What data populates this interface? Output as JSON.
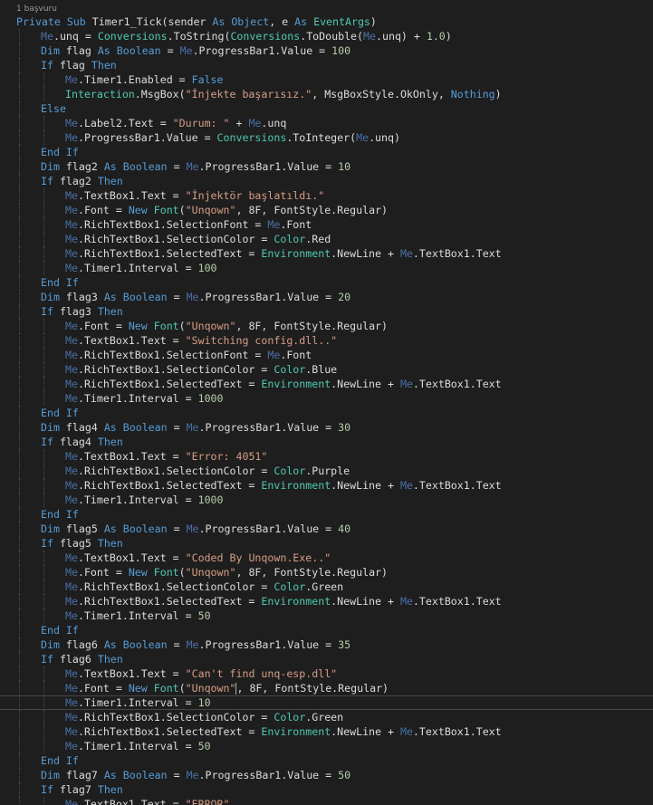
{
  "editor": {
    "codelens": "1 başvuru",
    "current_line": 47,
    "colors": {
      "background": "#1e1e1e",
      "keyword": "#569cd6",
      "type": "#4ec9b0",
      "string": "#d69d85",
      "number": "#b5cea8",
      "identifier": "#dcdcdc",
      "me": "#4a6fa5"
    },
    "lines": [
      {
        "indent": 0,
        "tokens": [
          [
            "kw",
            "Private Sub "
          ],
          [
            "id",
            "Timer1_Tick(sender "
          ],
          [
            "kw",
            "As Object"
          ],
          [
            "id",
            ", e "
          ],
          [
            "kw",
            "As "
          ],
          [
            "ty",
            "EventArgs"
          ],
          [
            "id",
            ")"
          ]
        ]
      },
      {
        "indent": 1,
        "tokens": [
          [
            "me",
            "Me"
          ],
          [
            "id",
            ".unq = "
          ],
          [
            "ty",
            "Conversions"
          ],
          [
            "id",
            ".ToString("
          ],
          [
            "ty",
            "Conversions"
          ],
          [
            "id",
            ".ToDouble("
          ],
          [
            "me",
            "Me"
          ],
          [
            "id",
            ".unq) + "
          ],
          [
            "num",
            "1.0"
          ],
          [
            "id",
            ")"
          ]
        ]
      },
      {
        "indent": 1,
        "tokens": [
          [
            "kw",
            "Dim "
          ],
          [
            "id",
            "flag "
          ],
          [
            "kw",
            "As Boolean"
          ],
          [
            "id",
            " = "
          ],
          [
            "me",
            "Me"
          ],
          [
            "id",
            ".ProgressBar1.Value = "
          ],
          [
            "num",
            "100"
          ]
        ]
      },
      {
        "indent": 1,
        "tokens": [
          [
            "kw",
            "If "
          ],
          [
            "id",
            "flag "
          ],
          [
            "kw",
            "Then"
          ]
        ]
      },
      {
        "indent": 2,
        "tokens": [
          [
            "me",
            "Me"
          ],
          [
            "id",
            ".Timer1.Enabled = "
          ],
          [
            "kw",
            "False"
          ]
        ]
      },
      {
        "indent": 2,
        "tokens": [
          [
            "ty",
            "Interaction"
          ],
          [
            "id",
            ".MsgBox("
          ],
          [
            "str",
            "\"İnjekte başarısız.\""
          ],
          [
            "id",
            ", MsgBoxStyle.OkOnly, "
          ],
          [
            "kw",
            "Nothing"
          ],
          [
            "id",
            ")"
          ]
        ]
      },
      {
        "indent": 1,
        "tokens": [
          [
            "kw",
            "Else"
          ]
        ]
      },
      {
        "indent": 2,
        "tokens": [
          [
            "me",
            "Me"
          ],
          [
            "id",
            ".Label2.Text = "
          ],
          [
            "str",
            "\"Durum: \""
          ],
          [
            "id",
            " + "
          ],
          [
            "me",
            "Me"
          ],
          [
            "id",
            ".unq"
          ]
        ]
      },
      {
        "indent": 2,
        "tokens": [
          [
            "me",
            "Me"
          ],
          [
            "id",
            ".ProgressBar1.Value = "
          ],
          [
            "ty",
            "Conversions"
          ],
          [
            "id",
            ".ToInteger("
          ],
          [
            "me",
            "Me"
          ],
          [
            "id",
            ".unq)"
          ]
        ]
      },
      {
        "indent": 1,
        "tokens": [
          [
            "kw",
            "End If"
          ]
        ]
      },
      {
        "indent": 1,
        "tokens": [
          [
            "kw",
            "Dim "
          ],
          [
            "id",
            "flag2 "
          ],
          [
            "kw",
            "As Boolean"
          ],
          [
            "id",
            " = "
          ],
          [
            "me",
            "Me"
          ],
          [
            "id",
            ".ProgressBar1.Value = "
          ],
          [
            "num",
            "10"
          ]
        ]
      },
      {
        "indent": 1,
        "tokens": [
          [
            "kw",
            "If "
          ],
          [
            "id",
            "flag2 "
          ],
          [
            "kw",
            "Then"
          ]
        ]
      },
      {
        "indent": 2,
        "tokens": [
          [
            "me",
            "Me"
          ],
          [
            "id",
            ".TextBox1.Text = "
          ],
          [
            "str",
            "\"İnjektör başlatıldı.\""
          ]
        ]
      },
      {
        "indent": 2,
        "tokens": [
          [
            "me",
            "Me"
          ],
          [
            "id",
            ".Font = "
          ],
          [
            "kw",
            "New "
          ],
          [
            "ty",
            "Font"
          ],
          [
            "id",
            "("
          ],
          [
            "str",
            "\"Unqown\""
          ],
          [
            "id",
            ", 8F, FontStyle.Regular)"
          ]
        ]
      },
      {
        "indent": 2,
        "tokens": [
          [
            "me",
            "Me"
          ],
          [
            "id",
            ".RichTextBox1.SelectionFont = "
          ],
          [
            "me",
            "Me"
          ],
          [
            "id",
            ".Font"
          ]
        ]
      },
      {
        "indent": 2,
        "tokens": [
          [
            "me",
            "Me"
          ],
          [
            "id",
            ".RichTextBox1.SelectionColor = "
          ],
          [
            "ty",
            "Color"
          ],
          [
            "id",
            ".Red"
          ]
        ]
      },
      {
        "indent": 2,
        "tokens": [
          [
            "me",
            "Me"
          ],
          [
            "id",
            ".RichTextBox1.SelectedText = "
          ],
          [
            "ty",
            "Environment"
          ],
          [
            "id",
            ".NewLine + "
          ],
          [
            "me",
            "Me"
          ],
          [
            "id",
            ".TextBox1.Text"
          ]
        ]
      },
      {
        "indent": 2,
        "tokens": [
          [
            "me",
            "Me"
          ],
          [
            "id",
            ".Timer1.Interval = "
          ],
          [
            "num",
            "100"
          ]
        ]
      },
      {
        "indent": 1,
        "tokens": [
          [
            "kw",
            "End If"
          ]
        ]
      },
      {
        "indent": 1,
        "tokens": [
          [
            "kw",
            "Dim "
          ],
          [
            "id",
            "flag3 "
          ],
          [
            "kw",
            "As Boolean"
          ],
          [
            "id",
            " = "
          ],
          [
            "me",
            "Me"
          ],
          [
            "id",
            ".ProgressBar1.Value = "
          ],
          [
            "num",
            "20"
          ]
        ]
      },
      {
        "indent": 1,
        "tokens": [
          [
            "kw",
            "If "
          ],
          [
            "id",
            "flag3 "
          ],
          [
            "kw",
            "Then"
          ]
        ]
      },
      {
        "indent": 2,
        "tokens": [
          [
            "me",
            "Me"
          ],
          [
            "id",
            ".Font = "
          ],
          [
            "kw",
            "New "
          ],
          [
            "ty",
            "Font"
          ],
          [
            "id",
            "("
          ],
          [
            "str",
            "\"Unqown\""
          ],
          [
            "id",
            ", 8F, FontStyle.Regular)"
          ]
        ]
      },
      {
        "indent": 2,
        "tokens": [
          [
            "me",
            "Me"
          ],
          [
            "id",
            ".TextBox1.Text = "
          ],
          [
            "str",
            "\"Switching config.dll..\""
          ]
        ]
      },
      {
        "indent": 2,
        "tokens": [
          [
            "me",
            "Me"
          ],
          [
            "id",
            ".RichTextBox1.SelectionFont = "
          ],
          [
            "me",
            "Me"
          ],
          [
            "id",
            ".Font"
          ]
        ]
      },
      {
        "indent": 2,
        "tokens": [
          [
            "me",
            "Me"
          ],
          [
            "id",
            ".RichTextBox1.SelectionColor = "
          ],
          [
            "ty",
            "Color"
          ],
          [
            "id",
            ".Blue"
          ]
        ]
      },
      {
        "indent": 2,
        "tokens": [
          [
            "me",
            "Me"
          ],
          [
            "id",
            ".RichTextBox1.SelectedText = "
          ],
          [
            "ty",
            "Environment"
          ],
          [
            "id",
            ".NewLine + "
          ],
          [
            "me",
            "Me"
          ],
          [
            "id",
            ".TextBox1.Text"
          ]
        ]
      },
      {
        "indent": 2,
        "tokens": [
          [
            "me",
            "Me"
          ],
          [
            "id",
            ".Timer1.Interval = "
          ],
          [
            "num",
            "1000"
          ]
        ]
      },
      {
        "indent": 1,
        "tokens": [
          [
            "kw",
            "End If"
          ]
        ]
      },
      {
        "indent": 1,
        "tokens": [
          [
            "kw",
            "Dim "
          ],
          [
            "id",
            "flag4 "
          ],
          [
            "kw",
            "As Boolean"
          ],
          [
            "id",
            " = "
          ],
          [
            "me",
            "Me"
          ],
          [
            "id",
            ".ProgressBar1.Value = "
          ],
          [
            "num",
            "30"
          ]
        ]
      },
      {
        "indent": 1,
        "tokens": [
          [
            "kw",
            "If "
          ],
          [
            "id",
            "flag4 "
          ],
          [
            "kw",
            "Then"
          ]
        ]
      },
      {
        "indent": 2,
        "tokens": [
          [
            "me",
            "Me"
          ],
          [
            "id",
            ".TextBox1.Text = "
          ],
          [
            "str",
            "\"Error: 4051\""
          ]
        ]
      },
      {
        "indent": 2,
        "tokens": [
          [
            "me",
            "Me"
          ],
          [
            "id",
            ".RichTextBox1.SelectionColor = "
          ],
          [
            "ty",
            "Color"
          ],
          [
            "id",
            ".Purple"
          ]
        ]
      },
      {
        "indent": 2,
        "tokens": [
          [
            "me",
            "Me"
          ],
          [
            "id",
            ".RichTextBox1.SelectedText = "
          ],
          [
            "ty",
            "Environment"
          ],
          [
            "id",
            ".NewLine + "
          ],
          [
            "me",
            "Me"
          ],
          [
            "id",
            ".TextBox1.Text"
          ]
        ]
      },
      {
        "indent": 2,
        "tokens": [
          [
            "me",
            "Me"
          ],
          [
            "id",
            ".Timer1.Interval = "
          ],
          [
            "num",
            "1000"
          ]
        ]
      },
      {
        "indent": 1,
        "tokens": [
          [
            "kw",
            "End If"
          ]
        ]
      },
      {
        "indent": 1,
        "tokens": [
          [
            "kw",
            "Dim "
          ],
          [
            "id",
            "flag5 "
          ],
          [
            "kw",
            "As Boolean"
          ],
          [
            "id",
            " = "
          ],
          [
            "me",
            "Me"
          ],
          [
            "id",
            ".ProgressBar1.Value = "
          ],
          [
            "num",
            "40"
          ]
        ]
      },
      {
        "indent": 1,
        "tokens": [
          [
            "kw",
            "If "
          ],
          [
            "id",
            "flag5 "
          ],
          [
            "kw",
            "Then"
          ]
        ]
      },
      {
        "indent": 2,
        "tokens": [
          [
            "me",
            "Me"
          ],
          [
            "id",
            ".TextBox1.Text = "
          ],
          [
            "str",
            "\"Coded By Unqown.Exe..\""
          ]
        ]
      },
      {
        "indent": 2,
        "tokens": [
          [
            "me",
            "Me"
          ],
          [
            "id",
            ".Font = "
          ],
          [
            "kw",
            "New "
          ],
          [
            "ty",
            "Font"
          ],
          [
            "id",
            "("
          ],
          [
            "str",
            "\"Unqown\""
          ],
          [
            "id",
            ", 8F, FontStyle.Regular)"
          ]
        ]
      },
      {
        "indent": 2,
        "tokens": [
          [
            "me",
            "Me"
          ],
          [
            "id",
            ".RichTextBox1.SelectionColor = "
          ],
          [
            "ty",
            "Color"
          ],
          [
            "id",
            ".Green"
          ]
        ]
      },
      {
        "indent": 2,
        "tokens": [
          [
            "me",
            "Me"
          ],
          [
            "id",
            ".RichTextBox1.SelectedText = "
          ],
          [
            "ty",
            "Environment"
          ],
          [
            "id",
            ".NewLine + "
          ],
          [
            "me",
            "Me"
          ],
          [
            "id",
            ".TextBox1.Text"
          ]
        ]
      },
      {
        "indent": 2,
        "tokens": [
          [
            "me",
            "Me"
          ],
          [
            "id",
            ".Timer1.Interval = "
          ],
          [
            "num",
            "50"
          ]
        ]
      },
      {
        "indent": 1,
        "tokens": [
          [
            "kw",
            "End If"
          ]
        ]
      },
      {
        "indent": 1,
        "tokens": [
          [
            "kw",
            "Dim "
          ],
          [
            "id",
            "flag6 "
          ],
          [
            "kw",
            "As Boolean"
          ],
          [
            "id",
            " = "
          ],
          [
            "me",
            "Me"
          ],
          [
            "id",
            ".ProgressBar1.Value = "
          ],
          [
            "num",
            "35"
          ]
        ]
      },
      {
        "indent": 1,
        "tokens": [
          [
            "kw",
            "If "
          ],
          [
            "id",
            "flag6 "
          ],
          [
            "kw",
            "Then"
          ]
        ]
      },
      {
        "indent": 2,
        "tokens": [
          [
            "me",
            "Me"
          ],
          [
            "id",
            ".TextBox1.Text = "
          ],
          [
            "str",
            "\"Can't find unq-esp.dll\""
          ]
        ]
      },
      {
        "indent": 2,
        "caret_after_token": 5,
        "tokens": [
          [
            "me",
            "Me"
          ],
          [
            "id",
            ".Font = "
          ],
          [
            "kw",
            "New "
          ],
          [
            "ty",
            "Font"
          ],
          [
            "id",
            "("
          ],
          [
            "str",
            "\"Unqown\""
          ],
          [
            "id",
            ", 8F, FontStyle.Regular)"
          ]
        ]
      },
      {
        "indent": 2,
        "tokens": [
          [
            "me",
            "Me"
          ],
          [
            "id",
            ".Timer1.Interval = "
          ],
          [
            "num",
            "10"
          ]
        ]
      },
      {
        "indent": 2,
        "tokens": [
          [
            "me",
            "Me"
          ],
          [
            "id",
            ".RichTextBox1.SelectionColor = "
          ],
          [
            "ty",
            "Color"
          ],
          [
            "id",
            ".Green"
          ]
        ]
      },
      {
        "indent": 2,
        "tokens": [
          [
            "me",
            "Me"
          ],
          [
            "id",
            ".RichTextBox1.SelectedText = "
          ],
          [
            "ty",
            "Environment"
          ],
          [
            "id",
            ".NewLine + "
          ],
          [
            "me",
            "Me"
          ],
          [
            "id",
            ".TextBox1.Text"
          ]
        ]
      },
      {
        "indent": 2,
        "tokens": [
          [
            "me",
            "Me"
          ],
          [
            "id",
            ".Timer1.Interval = "
          ],
          [
            "num",
            "50"
          ]
        ]
      },
      {
        "indent": 1,
        "tokens": [
          [
            "kw",
            "End If"
          ]
        ]
      },
      {
        "indent": 1,
        "tokens": [
          [
            "kw",
            "Dim "
          ],
          [
            "id",
            "flag7 "
          ],
          [
            "kw",
            "As Boolean"
          ],
          [
            "id",
            " = "
          ],
          [
            "me",
            "Me"
          ],
          [
            "id",
            ".ProgressBar1.Value = "
          ],
          [
            "num",
            "50"
          ]
        ]
      },
      {
        "indent": 1,
        "tokens": [
          [
            "kw",
            "If "
          ],
          [
            "id",
            "flag7 "
          ],
          [
            "kw",
            "Then"
          ]
        ]
      },
      {
        "indent": 2,
        "tokens": [
          [
            "me",
            "Me"
          ],
          [
            "id",
            ".TextBox1.Text = "
          ],
          [
            "str",
            "\"ERROR\""
          ]
        ]
      }
    ]
  }
}
